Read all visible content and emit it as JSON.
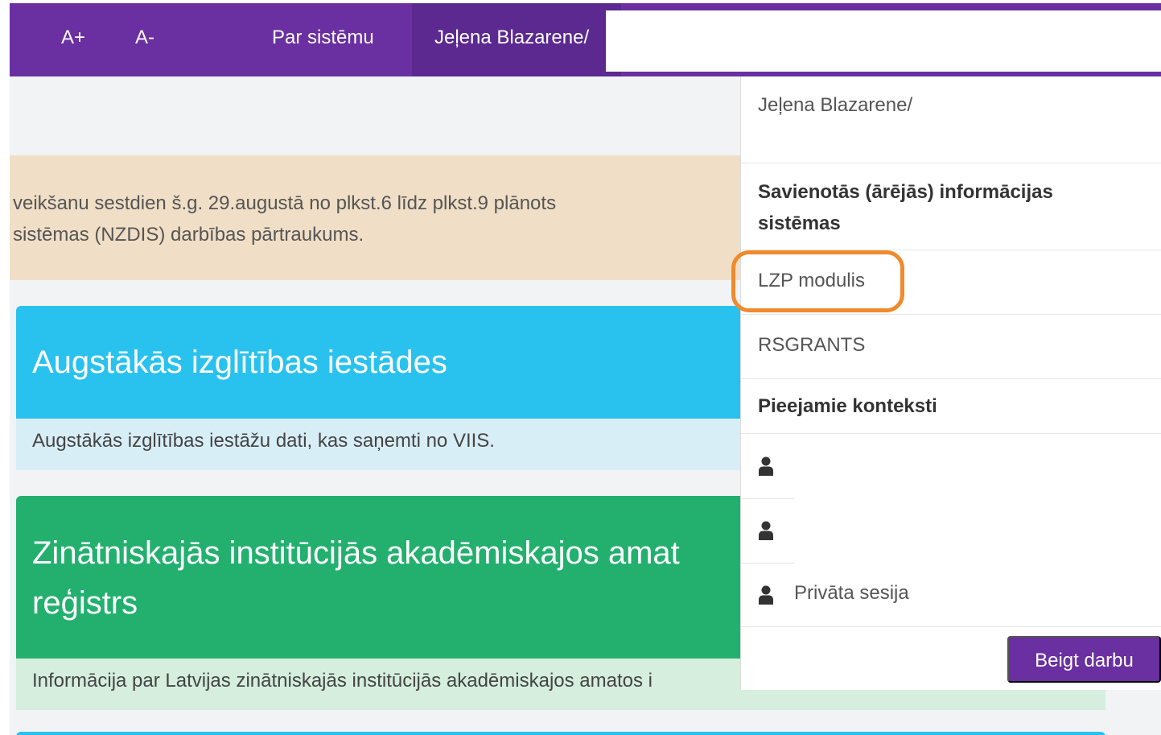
{
  "topnav": {
    "font_increase": "A+",
    "font_decrease": "A-",
    "about": "Par sistēmu",
    "user": "Jeļena Blazarene/"
  },
  "alert": {
    "text": "veikšanu sestdien š.g. 29.augustā no plkst.6 līdz plkst.9 plānots\nsistēmas (NZDIS) darbības pārtraukums."
  },
  "cards": {
    "higher_ed": {
      "title": "Augstākās izglītības iestādes",
      "description": "Augstākās izglītības iestāžu dati, kas saņemti no VIIS."
    },
    "science": {
      "title": "Zinātniskajās institūcijās akadēmiskajos amat\nreģistrs",
      "description": "Informācija par Latvijas zinātniskajās institūcijās akadēmiskajos amatos i"
    }
  },
  "dropdown": {
    "user_name": "Jeļena Blazarene/",
    "external_systems_header": "Savienotās (ārējās) informācijas sistēmas",
    "items": [
      "LZP modulis",
      "RSGRANTS"
    ],
    "contexts_header": "Pieejamie konteksti",
    "contexts": [
      "",
      "",
      "Privāta sesija"
    ],
    "logout": "Beigt darbu"
  },
  "colors": {
    "nav": "#6a2fa0",
    "alert": "#f0dfc6",
    "card_blue": "#29c2ef",
    "card_green": "#23b06e",
    "highlight": "#f08a2c"
  },
  "icons": {
    "context": "person-icon"
  }
}
